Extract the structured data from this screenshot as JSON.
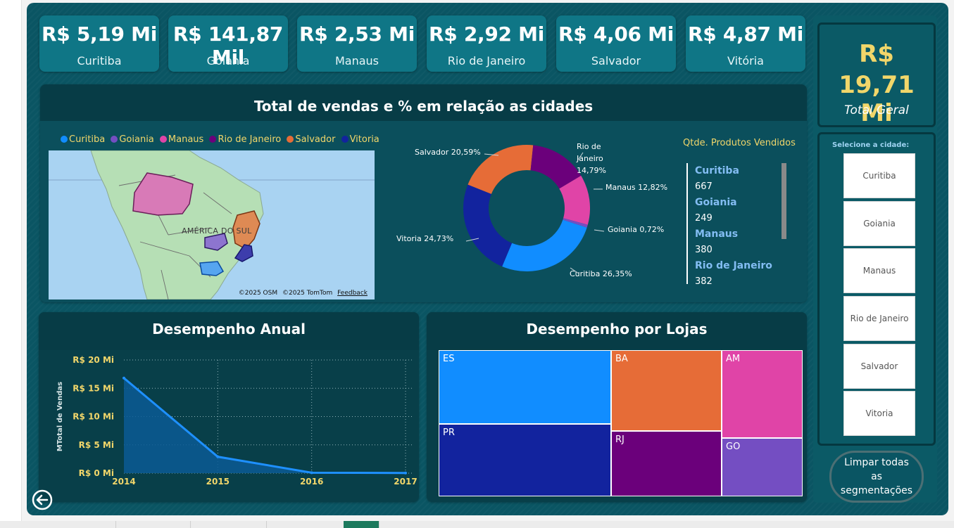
{
  "kpis": [
    {
      "value": "R$ 5,19 Mi",
      "city": "Curitiba"
    },
    {
      "value": "R$ 141,87 Mil",
      "city": "Goiania"
    },
    {
      "value": "R$ 2,53 Mi",
      "city": "Manaus"
    },
    {
      "value": "R$ 2,92 Mi",
      "city": "Rio de Janeiro"
    },
    {
      "value": "R$ 4,06 Mi",
      "city": "Salvador"
    },
    {
      "value": "R$ 4,87 Mi",
      "city": "Vitória"
    }
  ],
  "total": {
    "line1": "R$",
    "line2": "19,71 Mi",
    "label": "Total Geral"
  },
  "colors": {
    "curitiba": "#118dff",
    "goiania": "#744ec2",
    "manaus": "#e044a7",
    "rio": "#6b007b",
    "salvador": "#e66c37",
    "vitoria": "#12239e",
    "accent_yellow": "#f1d66a",
    "canvas": "#0a5563"
  },
  "sales_panel": {
    "title": "Total de vendas e % em relação as cidades",
    "legend": [
      "Curitiba",
      "Goiania",
      "Manaus",
      "Rio de Janeiro",
      "Salvador",
      "Vitoria"
    ],
    "map": {
      "label": "AMÉRICA DO SUL",
      "attr_osm": "©2025 OSM",
      "attr_tomtom": "©2025 TomTom",
      "feedback": "Feedback"
    }
  },
  "qtde": {
    "title": "Qtde. Produtos Vendidos",
    "items": [
      {
        "city": "Curitiba",
        "qty": "667"
      },
      {
        "city": "Goiania",
        "qty": "249"
      },
      {
        "city": "Manaus",
        "qty": "380"
      },
      {
        "city": "Rio de Janeiro",
        "qty": "382"
      }
    ]
  },
  "annual": {
    "title": "Desempenho Anual"
  },
  "stores": {
    "title": "Desempenho por Lojas"
  },
  "slicer": {
    "title": "Selecione a cidade:",
    "options": [
      "Curitiba",
      "Goiania",
      "Manaus",
      "Rio de Janeiro",
      "Salvador",
      "Vitoria"
    ]
  },
  "clear_button": "Limpar todas as segmentações",
  "chart_data": [
    {
      "type": "pie",
      "categories": [
        "Curitiba",
        "Goiania",
        "Manaus",
        "Rio de Janeiro",
        "Salvador",
        "Vitoria"
      ],
      "values": [
        26.35,
        0.72,
        12.82,
        14.79,
        20.59,
        24.73
      ],
      "labels": [
        "Curitiba 26,35%",
        "Goiania 0,72%",
        "Manaus 12,82%",
        "Rio de Janeiro 14,79%",
        "Salvador 20,59%",
        "Vitoria 24,73%"
      ]
    },
    {
      "type": "area",
      "x": [
        "2014",
        "2015",
        "2016",
        "2017"
      ],
      "values": [
        16800000,
        2900000,
        80000,
        30000
      ],
      "ylabel": "MTotal de Vendas",
      "ylim": [
        0,
        20000000
      ],
      "yticks": [
        "R$ 0 Mi",
        "R$ 5 Mi",
        "R$ 10 Mi",
        "R$ 15 Mi",
        "R$ 20 Mi"
      ],
      "grid": true
    },
    {
      "type": "treemap",
      "categories": [
        "ES",
        "PR",
        "BA",
        "RJ",
        "AM",
        "GO"
      ]
    }
  ]
}
